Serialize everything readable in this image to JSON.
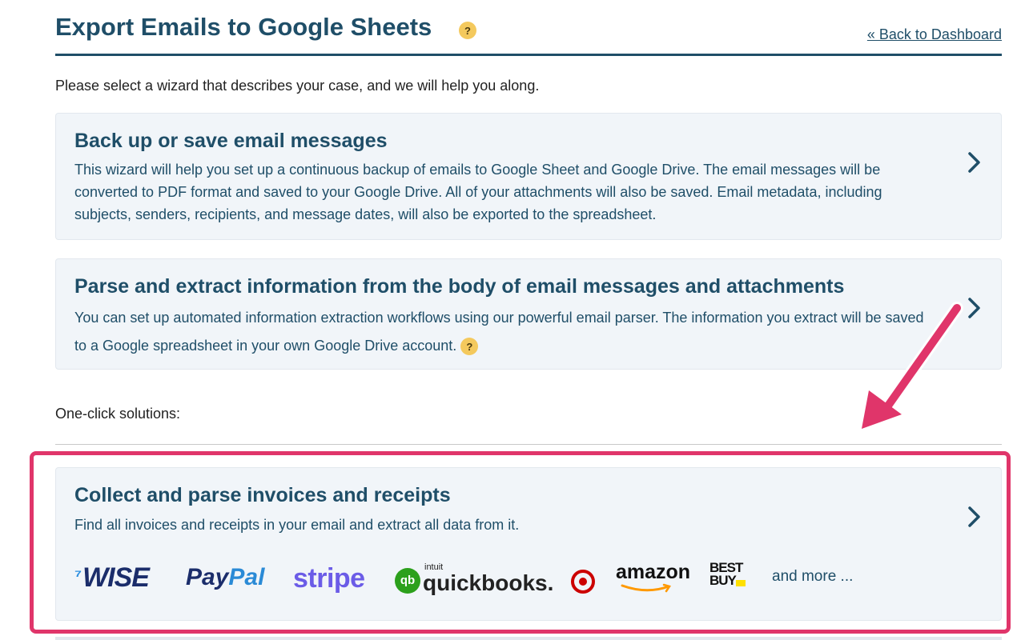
{
  "header": {
    "title": "Export Emails to Google Sheets",
    "help_badge": "?",
    "back_link": "« Back to Dashboard"
  },
  "intro": "Please select a wizard that describes your case, and we will help you along.",
  "wizards": [
    {
      "title": "Back up or save email messages",
      "description": "This wizard will help you set up a continuous backup of emails to Google Sheet and Google Drive. The email messages will be converted to PDF format and saved to your Google Drive. All of your attachments will also be saved. Email metadata, including subjects, senders, recipients, and message dates, will also be exported to the spreadsheet."
    },
    {
      "title": "Parse and extract information from the body of email messages and attachments",
      "description": "You can set up automated information extraction workflows using our powerful email parser. The information you extract will be saved to a Google spreadsheet in your own Google Drive account.",
      "help_badge": "?"
    }
  ],
  "one_click": {
    "label": "One-click solutions:",
    "solution": {
      "title": "Collect and parse invoices and receipts",
      "description": "Find all invoices and receipts in your email and extract all data from it.",
      "logos": {
        "wise": "WISE",
        "paypal_1": "Pay",
        "paypal_2": "Pal",
        "stripe": "stripe",
        "qb_mark": "qb",
        "qb_intuit": "intuit",
        "quickbooks": "quickbooks.",
        "amazon": "amazon",
        "bestbuy_1": "BEST",
        "bestbuy_2": "BUY",
        "more": "and more ..."
      }
    }
  },
  "colors": {
    "primary": "#1f4e68",
    "card_bg": "#f1f5f9",
    "help_badge": "#f4c95d",
    "highlight": "#e0356a"
  },
  "icons": [
    "help-icon",
    "chevron-right-icon",
    "annotation-arrow-icon",
    "target-logo-icon"
  ]
}
